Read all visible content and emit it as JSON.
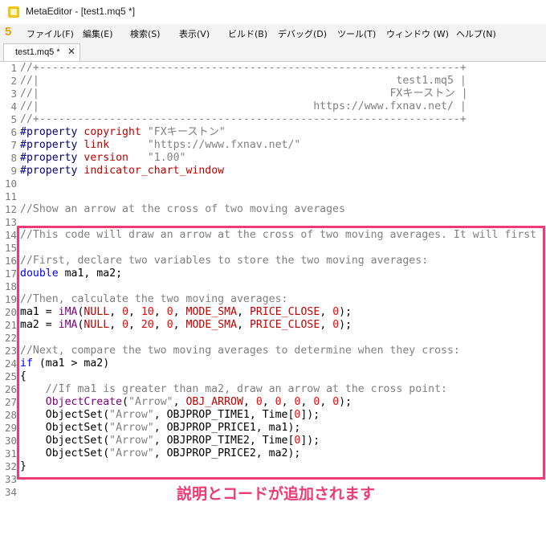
{
  "window": {
    "title": "MetaEditor - [test1.mq5 *]"
  },
  "menubar": {
    "logo": "5",
    "items": [
      "ファイル(F)",
      "編集(E)",
      "検索(S)",
      "表示(V)",
      "ビルド(B)",
      "デバッグ(D)",
      "ツール(T)",
      "ウィンドウ (W)",
      "ヘルプ(N)"
    ]
  },
  "tabs": [
    {
      "label": "test1.mq5 *",
      "close": "✕"
    }
  ],
  "colors": {
    "comment": "#808080",
    "keyword": "#000080",
    "type": "#0000ff",
    "string": "#808080",
    "number": "#ff0000",
    "constant": "#c00000",
    "builtin": "#800080",
    "text": "#000000",
    "highlight": "#ef3b74"
  },
  "editor": {
    "lines": [
      [
        [
          "comment",
          "//+------------------------------------------------------------------+"
        ]
      ],
      [
        [
          "comment",
          "//|                                                        test1.mq5 |"
        ]
      ],
      [
        [
          "comment",
          "//|                                                       FXキーストン |"
        ]
      ],
      [
        [
          "comment",
          "//|                                           https://www.fxnav.net/ |"
        ]
      ],
      [
        [
          "comment",
          "//+------------------------------------------------------------------+"
        ]
      ],
      [
        [
          "keyword",
          "#property "
        ],
        [
          "constant",
          "copyright "
        ],
        [
          "string",
          "\"FXキーストン\""
        ]
      ],
      [
        [
          "keyword",
          "#property "
        ],
        [
          "constant",
          "link      "
        ],
        [
          "string",
          "\"https://www.fxnav.net/\""
        ]
      ],
      [
        [
          "keyword",
          "#property "
        ],
        [
          "constant",
          "version   "
        ],
        [
          "string",
          "\"1.00\""
        ]
      ],
      [
        [
          "keyword",
          "#property "
        ],
        [
          "constant",
          "indicator_chart_window"
        ]
      ],
      [],
      [],
      [
        [
          "comment",
          "//Show an arrow at the cross of two moving averages"
        ]
      ],
      [],
      [
        [
          "comment",
          "//This code will draw an arrow at the cross of two moving averages. It will first"
        ]
      ],
      [],
      [
        [
          "comment",
          "//First, declare two variables to store the two moving averages:"
        ]
      ],
      [
        [
          "type",
          "double"
        ],
        [
          "text",
          " ma1, ma2;"
        ]
      ],
      [],
      [
        [
          "comment",
          "//Then, calculate the two moving averages:"
        ]
      ],
      [
        [
          "text",
          "ma1 = "
        ],
        [
          "builtin",
          "iMA"
        ],
        [
          "text",
          "("
        ],
        [
          "constant",
          "NULL"
        ],
        [
          "text",
          ", "
        ],
        [
          "number",
          "0"
        ],
        [
          "text",
          ", "
        ],
        [
          "number",
          "10"
        ],
        [
          "text",
          ", "
        ],
        [
          "number",
          "0"
        ],
        [
          "text",
          ", "
        ],
        [
          "constant",
          "MODE_SMA"
        ],
        [
          "text",
          ", "
        ],
        [
          "constant",
          "PRICE_CLOSE"
        ],
        [
          "text",
          ", "
        ],
        [
          "number",
          "0"
        ],
        [
          "text",
          ");"
        ]
      ],
      [
        [
          "text",
          "ma2 = "
        ],
        [
          "builtin",
          "iMA"
        ],
        [
          "text",
          "("
        ],
        [
          "constant",
          "NULL"
        ],
        [
          "text",
          ", "
        ],
        [
          "number",
          "0"
        ],
        [
          "text",
          ", "
        ],
        [
          "number",
          "20"
        ],
        [
          "text",
          ", "
        ],
        [
          "number",
          "0"
        ],
        [
          "text",
          ", "
        ],
        [
          "constant",
          "MODE_SMA"
        ],
        [
          "text",
          ", "
        ],
        [
          "constant",
          "PRICE_CLOSE"
        ],
        [
          "text",
          ", "
        ],
        [
          "number",
          "0"
        ],
        [
          "text",
          ");"
        ]
      ],
      [],
      [
        [
          "comment",
          "//Next, compare the two moving averages to determine when they cross:"
        ]
      ],
      [
        [
          "type",
          "if"
        ],
        [
          "text",
          " (ma1 > ma2)"
        ]
      ],
      [
        [
          "text",
          "{"
        ]
      ],
      [
        [
          "comment",
          "    //If ma1 is greater than ma2, draw an arrow at the cross point:"
        ]
      ],
      [
        [
          "text",
          "    "
        ],
        [
          "builtin",
          "ObjectCreate"
        ],
        [
          "text",
          "("
        ],
        [
          "string",
          "\"Arrow\""
        ],
        [
          "text",
          ", "
        ],
        [
          "constant",
          "OBJ_ARROW"
        ],
        [
          "text",
          ", "
        ],
        [
          "number",
          "0"
        ],
        [
          "text",
          ", "
        ],
        [
          "number",
          "0"
        ],
        [
          "text",
          ", "
        ],
        [
          "number",
          "0"
        ],
        [
          "text",
          ", "
        ],
        [
          "number",
          "0"
        ],
        [
          "text",
          ", "
        ],
        [
          "number",
          "0"
        ],
        [
          "text",
          ");"
        ]
      ],
      [
        [
          "text",
          "    ObjectSet("
        ],
        [
          "string",
          "\"Arrow\""
        ],
        [
          "text",
          ", OBJPROP_TIME1, Time["
        ],
        [
          "number",
          "0"
        ],
        [
          "text",
          "]);"
        ]
      ],
      [
        [
          "text",
          "    ObjectSet("
        ],
        [
          "string",
          "\"Arrow\""
        ],
        [
          "text",
          ", OBJPROP_PRICE1, ma1);"
        ]
      ],
      [
        [
          "text",
          "    ObjectSet("
        ],
        [
          "string",
          "\"Arrow\""
        ],
        [
          "text",
          ", OBJPROP_TIME2, Time["
        ],
        [
          "number",
          "0"
        ],
        [
          "text",
          "]);"
        ]
      ],
      [
        [
          "text",
          "    ObjectSet("
        ],
        [
          "string",
          "\"Arrow\""
        ],
        [
          "text",
          ", OBJPROP_PRICE2, ma2);"
        ]
      ],
      [
        [
          "text",
          "}"
        ]
      ],
      [],
      []
    ]
  },
  "annotation": {
    "caption": "説明とコードが追加されます"
  }
}
